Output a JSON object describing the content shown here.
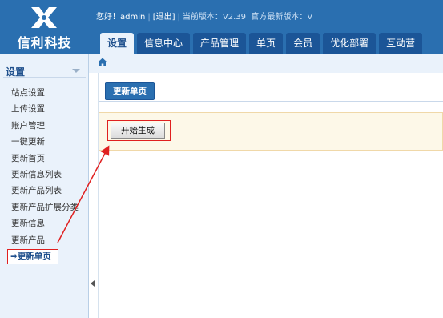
{
  "brand": {
    "name": "信利科技"
  },
  "topbar": {
    "greeting": "您好！",
    "username": "admin",
    "logout": "[退出]",
    "current_version_label": "当前版本：",
    "current_version": "V2.39",
    "latest_version_label": "官方最新版本：",
    "latest_version": "V"
  },
  "tabs": [
    {
      "label": "设置",
      "active": true
    },
    {
      "label": "信息中心"
    },
    {
      "label": "产品管理"
    },
    {
      "label": "单页"
    },
    {
      "label": "会员"
    },
    {
      "label": "优化部署"
    },
    {
      "label": "互动营"
    }
  ],
  "sidebar": {
    "title": "设置",
    "items": [
      {
        "label": "站点设置"
      },
      {
        "label": "上传设置"
      },
      {
        "label": "账户管理"
      },
      {
        "label": "一键更新"
      },
      {
        "label": "更新首页"
      },
      {
        "label": "更新信息列表"
      },
      {
        "label": "更新产品列表"
      },
      {
        "label": "更新产品扩展分类"
      },
      {
        "label": "更新信息"
      },
      {
        "label": "更新产品"
      },
      {
        "label": "更新单页",
        "current": true,
        "marker": "➡"
      }
    ]
  },
  "main": {
    "subtab_label": "更新单页",
    "generate_button": "开始生成"
  },
  "colors": {
    "header_blue": "#2a6fb0",
    "tab_dark": "#1b5597",
    "highlight_red": "#e02020",
    "panel_bg": "#fdf8e8"
  },
  "icons": {
    "home": "home-icon",
    "collapse": "triangle-left-icon",
    "sidebar_toggle": "triangle-down-icon"
  }
}
